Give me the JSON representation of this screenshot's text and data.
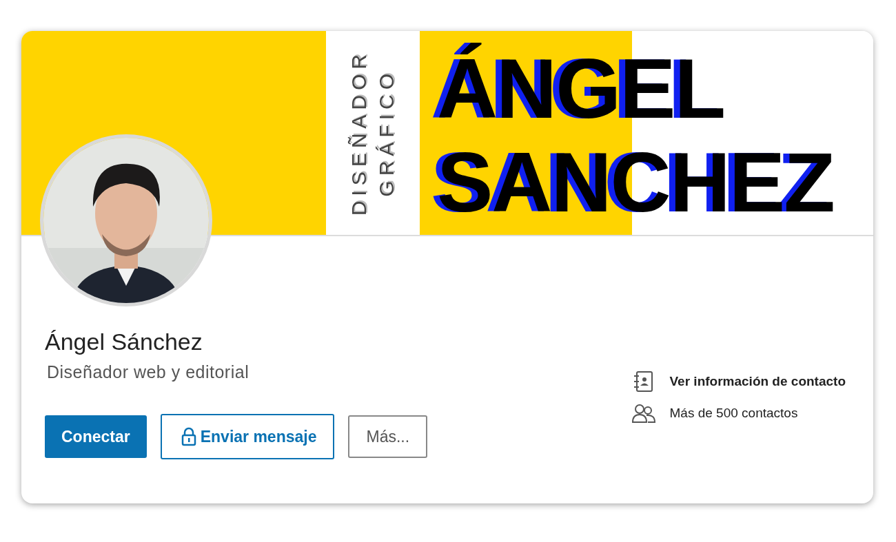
{
  "banner": {
    "subtitle_lines": [
      "DISEÑADOR",
      "GRÁFICO"
    ],
    "title_lines": [
      "ÁNGEL",
      "SANCHEZ"
    ]
  },
  "profile": {
    "name": "Ángel Sánchez",
    "headline": "Diseñador web y editorial"
  },
  "actions": [
    {
      "label": "Conectar",
      "kind": "primary"
    },
    {
      "label": "Enviar mensaje",
      "kind": "message"
    },
    {
      "label": "Más...",
      "kind": "more"
    }
  ],
  "contact_links": [
    {
      "label": "Ver información de contacto",
      "kind": "contact-info"
    },
    {
      "label": "Más de 500 contactos",
      "kind": "connections"
    }
  ]
}
